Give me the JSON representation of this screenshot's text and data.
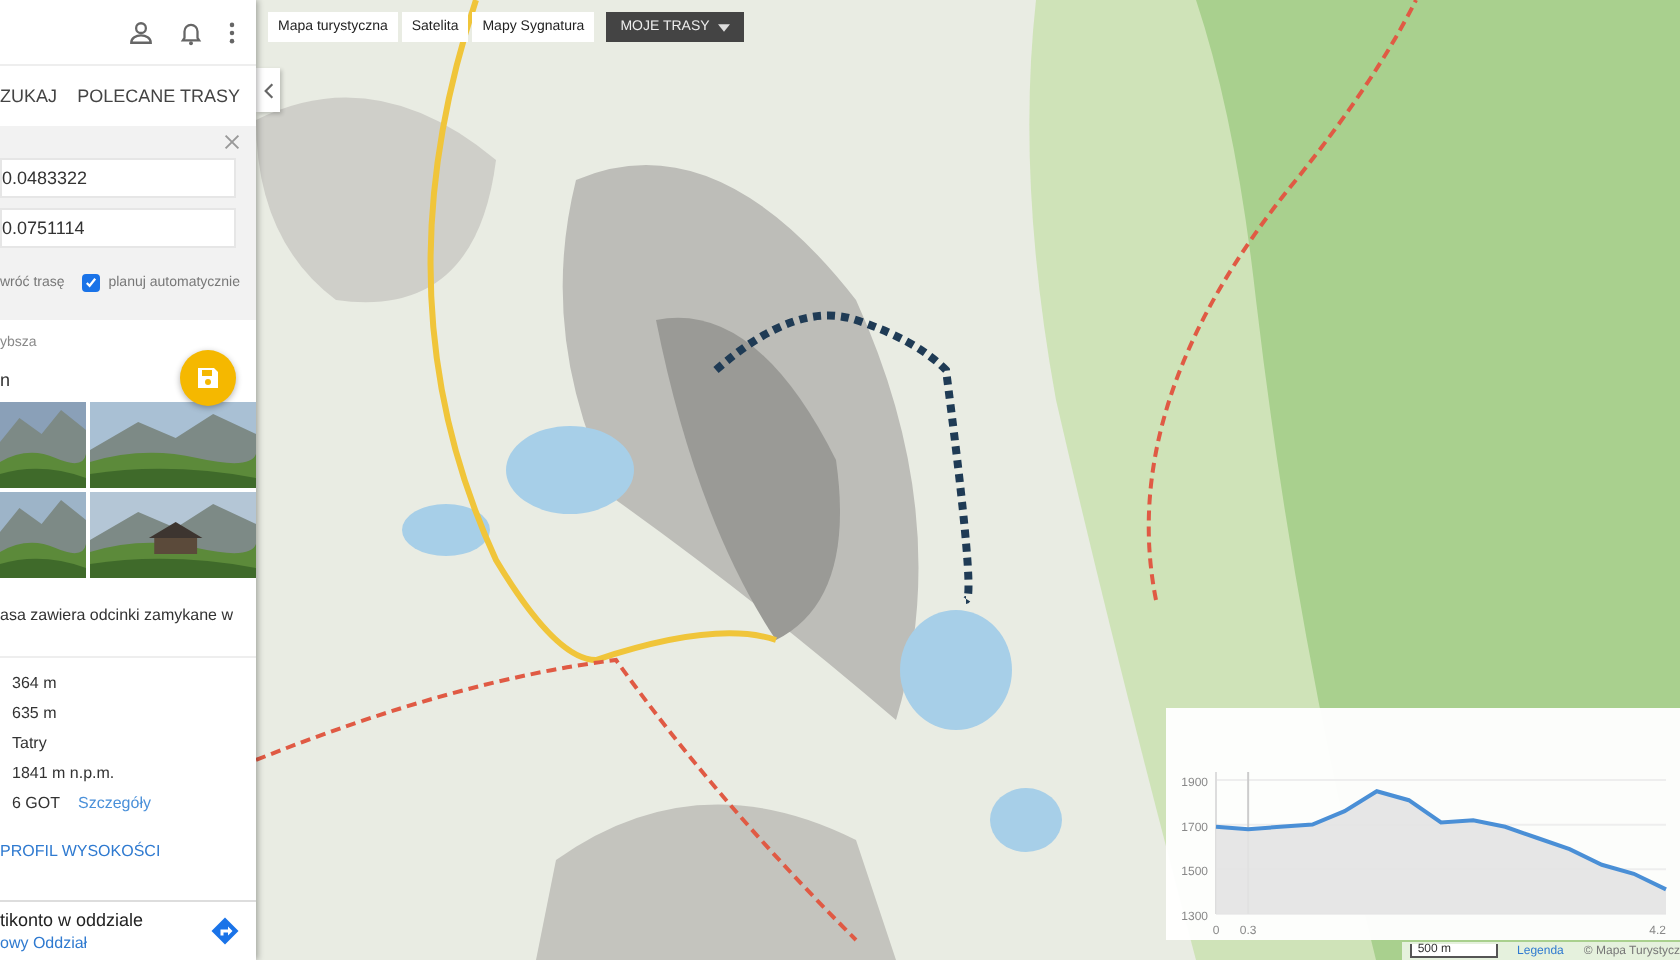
{
  "sidebar": {
    "tabs": [
      {
        "label": "ZUKAJ"
      },
      {
        "label": "POLECANE TRASY"
      }
    ],
    "route_form": {
      "points": [
        {
          "value": "0.0483322"
        },
        {
          "value": "0.0751114"
        }
      ],
      "reverse_label": "wróć trasę",
      "auto_plan": {
        "label": "planuj automatycznie",
        "checked": true
      }
    },
    "route_type": {
      "label": "ybsza",
      "value": "n"
    },
    "notice": "asa zawiera odcinki zamykane w",
    "stats": [
      "364 m",
      "635 m",
      "Tatry",
      "1841 m n.p.m.",
      "6 GOT"
    ],
    "details_link": "Szczegóły",
    "profile_button": "PROFIL WYSOKOŚCI",
    "ad": {
      "title": "tikonto w oddziale",
      "subtitle": "owy Oddział"
    }
  },
  "map": {
    "layers": [
      {
        "label": "Mapa turystyczna"
      },
      {
        "label": "Satelita"
      },
      {
        "label": "Mapy Sygnatura"
      }
    ],
    "my_routes": "MOJE TRASY",
    "scale": "500 m",
    "legend": "Legenda",
    "attribution": "© Mapa Turystycz"
  },
  "elevation": {
    "chart_data": {
      "type": "area",
      "x": [
        0,
        0.3,
        0.6,
        0.9,
        1.2,
        1.5,
        1.8,
        2.1,
        2.4,
        2.7,
        3.0,
        3.3,
        3.6,
        3.9,
        4.2
      ],
      "series": [
        {
          "color": "#4a8fd6",
          "values": [
            1690,
            1680,
            1690,
            1700,
            1760,
            1850,
            1810,
            1710,
            1720,
            1690,
            1640,
            1590,
            1520,
            1480,
            1410
          ]
        }
      ],
      "ref_lines": [
        {
          "axis": "x",
          "value": 0.3
        }
      ],
      "xlim": [
        0,
        4.2
      ],
      "ylim": [
        1300,
        1900
      ],
      "xticks": [
        0,
        0.3,
        4.2
      ],
      "yticks": [
        1300,
        1500,
        1700,
        1900
      ]
    }
  }
}
